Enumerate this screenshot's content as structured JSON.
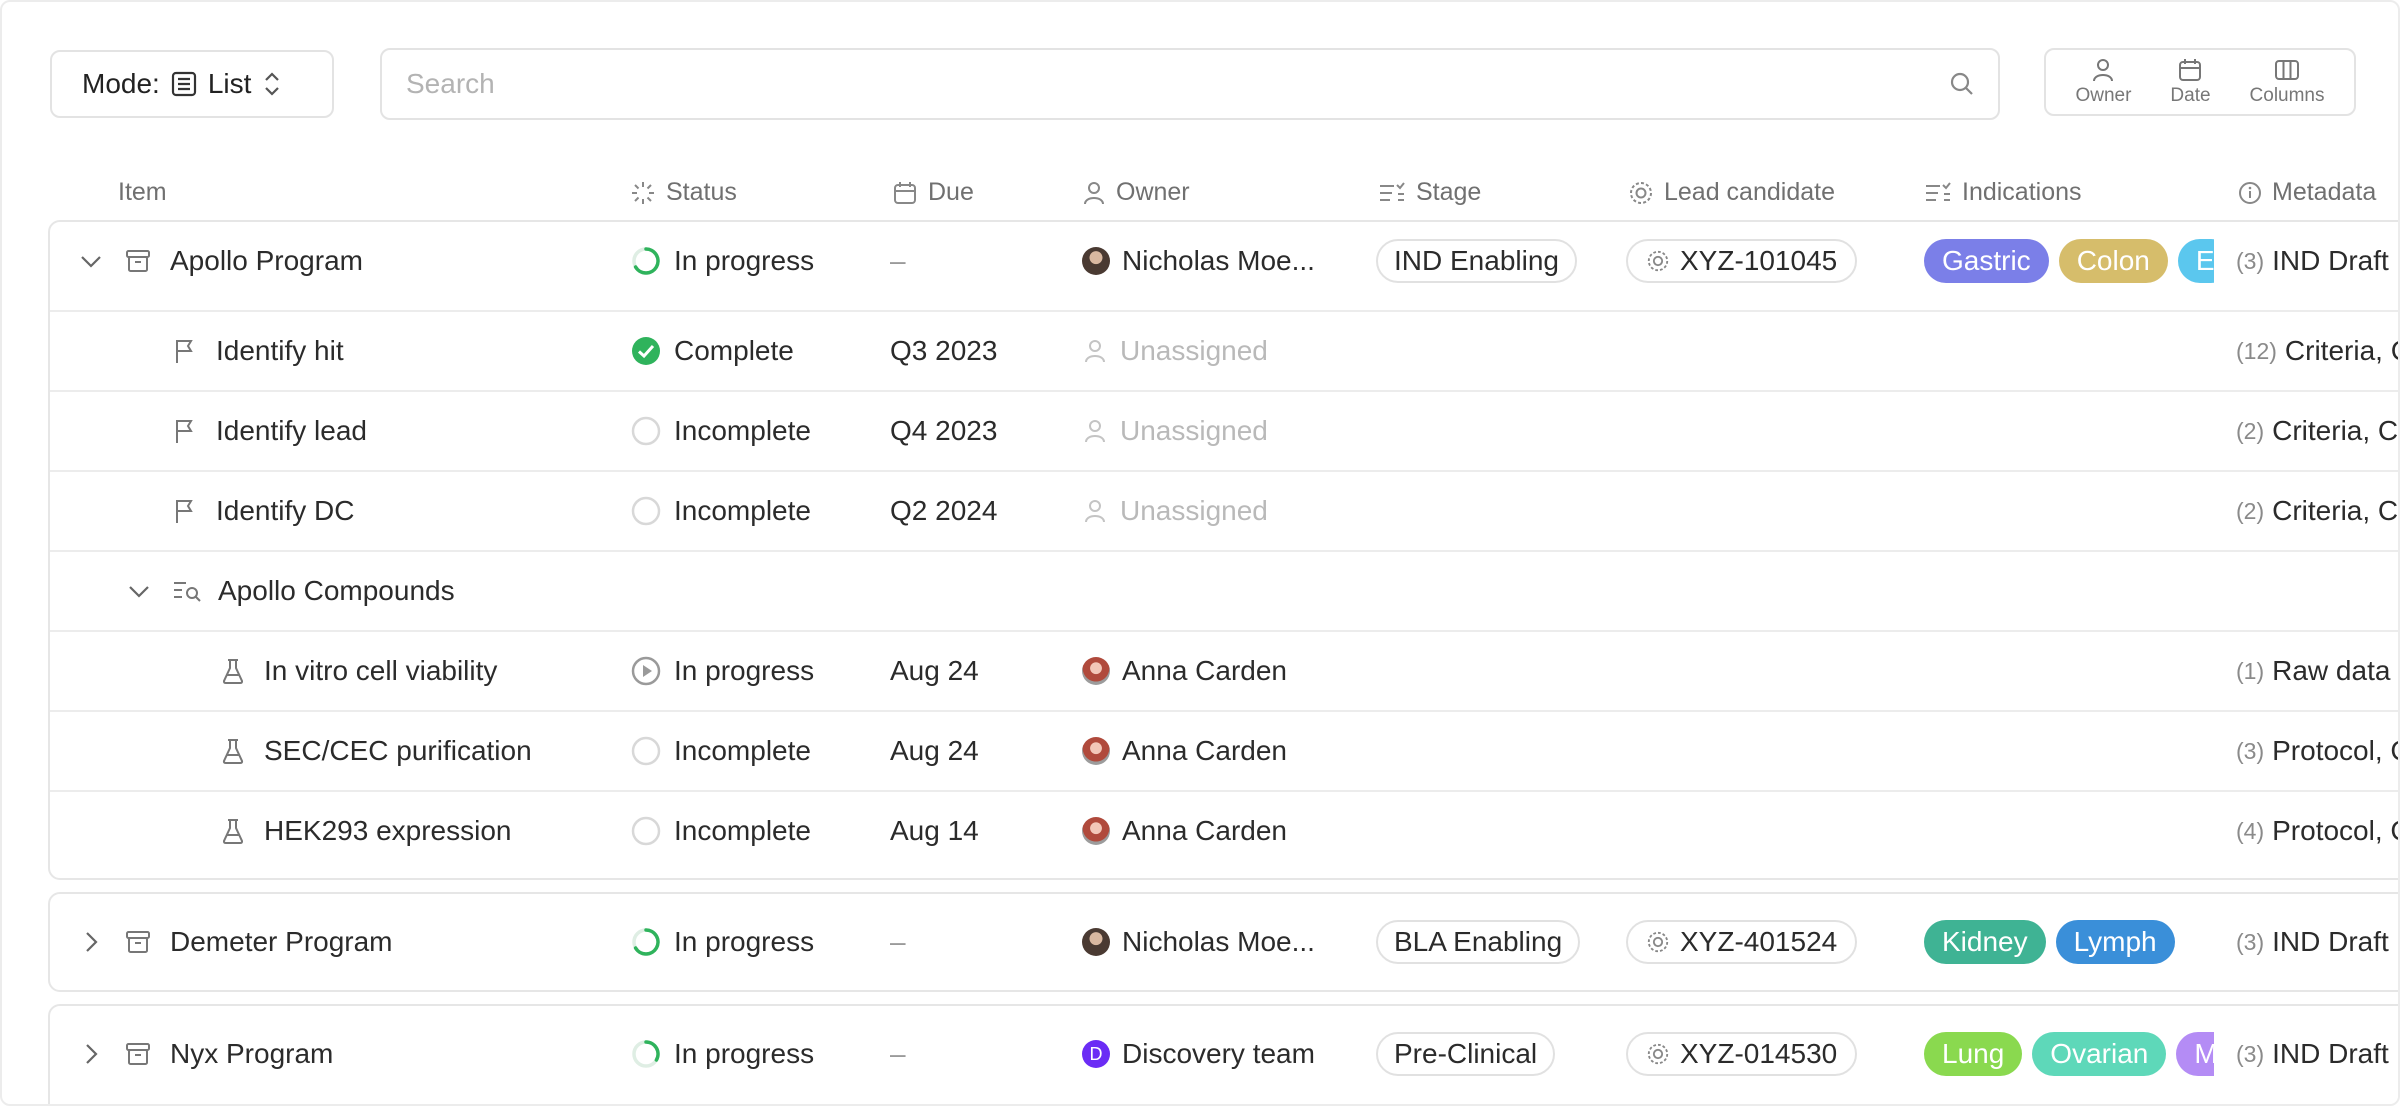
{
  "toolbar": {
    "mode_label": "Mode:",
    "mode_value": "List",
    "search_placeholder": "Search",
    "view_buttons": [
      {
        "label": "Owner",
        "icon": "person-icon"
      },
      {
        "label": "Date",
        "icon": "calendar-icon"
      },
      {
        "label": "Columns",
        "icon": "columns-icon"
      }
    ]
  },
  "columns": {
    "item": "Item",
    "status": "Status",
    "due": "Due",
    "owner": "Owner",
    "stage": "Stage",
    "lead_candidate": "Lead candidate",
    "indications": "Indications",
    "metadata": "Metadata"
  },
  "colors": {
    "complete": "#2fb35c",
    "progress": "#2fb35c",
    "tag_gastric": "#7b7fe8",
    "tag_colon": "#d6bd6b",
    "tag_e": "#5bc7ee",
    "tag_kidney": "#3fb394",
    "tag_lymph": "#3a8fd9",
    "tag_lung": "#8ad94f",
    "tag_ovarian": "#5ed8b9",
    "tag_m": "#b48cf5"
  },
  "programs": [
    {
      "name": "Apollo Program",
      "expanded": true,
      "status": "In progress",
      "due": "–",
      "owner": "Nicholas Moe...",
      "stage": "IND Enabling",
      "lead_candidate": "XYZ-101045",
      "indications": [
        "Gastric",
        "Colon",
        "E"
      ],
      "meta_count": "(3)",
      "meta_text": "IND Draft",
      "milestones": [
        {
          "name": "Identify hit",
          "status": "Complete",
          "due": "Q3 2023",
          "owner": "Unassigned",
          "meta_count": "(12)",
          "meta_text": "Criteria, C"
        },
        {
          "name": "Identify lead",
          "status": "Incomplete",
          "due": "Q4 2023",
          "owner": "Unassigned",
          "meta_count": "(2)",
          "meta_text": "Criteria, C"
        },
        {
          "name": "Identify DC",
          "status": "Incomplete",
          "due": "Q2 2024",
          "owner": "Unassigned",
          "meta_count": "(2)",
          "meta_text": "Criteria, C"
        }
      ],
      "group": {
        "name": "Apollo Compounds",
        "expanded": true,
        "experiments": [
          {
            "name": "In vitro cell viability",
            "status": "In progress",
            "due": "Aug 24",
            "owner": "Anna Carden",
            "meta_count": "(1)",
            "meta_text": "Raw data"
          },
          {
            "name": "SEC/CEC purification",
            "status": "Incomplete",
            "due": "Aug 24",
            "owner": "Anna Carden",
            "meta_count": "(3)",
            "meta_text": "Protocol, C"
          },
          {
            "name": "HEK293 expression",
            "status": "Incomplete",
            "due": "Aug 14",
            "owner": "Anna Carden",
            "meta_count": "(4)",
            "meta_text": "Protocol, C"
          }
        ]
      }
    },
    {
      "name": "Demeter Program",
      "expanded": false,
      "status": "In progress",
      "due": "–",
      "owner": "Nicholas Moe...",
      "stage": "BLA Enabling",
      "lead_candidate": "XYZ-401524",
      "indications": [
        "Kidney",
        "Lymph"
      ],
      "meta_count": "(3)",
      "meta_text": "IND Draft"
    },
    {
      "name": "Nyx Program",
      "expanded": false,
      "status": "In progress",
      "due": "–",
      "owner": "Discovery team",
      "owner_initial": "D",
      "stage": "Pre-Clinical",
      "lead_candidate": "XYZ-014530",
      "indications": [
        "Lung",
        "Ovarian",
        "M"
      ],
      "meta_count": "(3)",
      "meta_text": "IND Draft"
    }
  ]
}
